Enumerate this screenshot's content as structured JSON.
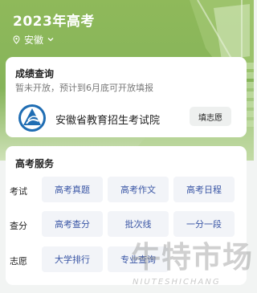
{
  "header": {
    "title": "2023年高考",
    "location": "安徽"
  },
  "score_query": {
    "title": "成绩查询",
    "notice": "暂未开放，预计到6月底可开放填报",
    "institution": "安徽省教育招生考试院",
    "fill_button": "填志愿"
  },
  "services": {
    "title": "高考服务",
    "rows": [
      {
        "label": "考试",
        "items": [
          "高考真题",
          "高考作文",
          "高考日程"
        ]
      },
      {
        "label": "查分",
        "items": [
          "高考查分",
          "批次线",
          "一分一段"
        ]
      },
      {
        "label": "志愿",
        "items": [
          "大学排行",
          "专业查询"
        ]
      }
    ]
  },
  "watermark": {
    "text": "牛特市场",
    "sub": "NIUTESHICHANG"
  },
  "colors": {
    "hero_green": "#8fb95a",
    "service_text": "#3a56a5",
    "logo_blue": "#1f6db3"
  },
  "icons": [
    "location-pin-icon",
    "chevron-down-icon",
    "institution-logo-icon"
  ]
}
